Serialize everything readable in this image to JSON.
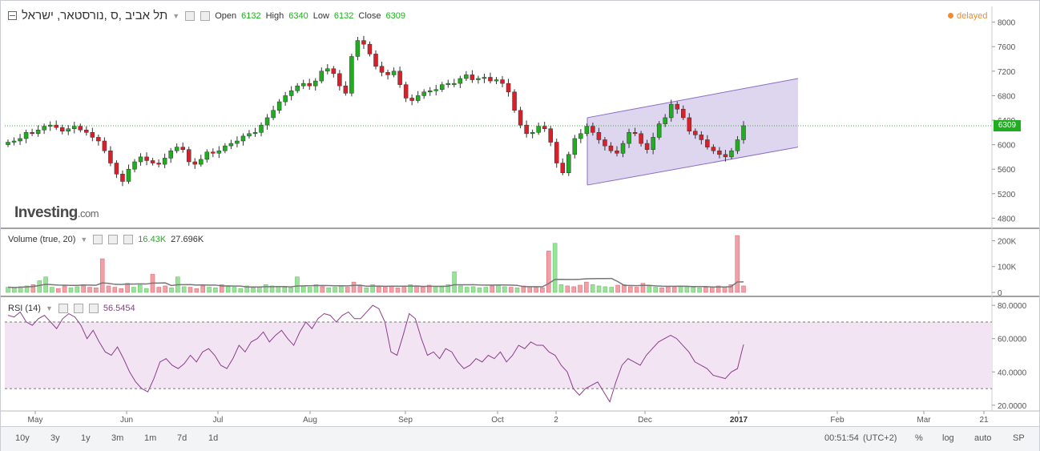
{
  "instrument_title": "תל אביב ,ס ,נורסטאר, ישראל",
  "ohlc": {
    "open_label": "Open",
    "open": "6132",
    "high_label": "High",
    "high": "6340",
    "low_label": "Low",
    "low": "6132",
    "close_label": "Close",
    "close": "6309"
  },
  "status": "delayed",
  "logo": {
    "main": "Investing",
    "suffix": ".com"
  },
  "volume_panel": {
    "label": "Volume (true, 20)",
    "value1": "16.43K",
    "value2": "27.696K"
  },
  "rsi_panel": {
    "label": "RSI (14)",
    "value": "56.5454"
  },
  "current_price_tag": "6309",
  "time_axis_labels": [
    "May",
    "Jun",
    "Jul",
    "Aug",
    "Sep",
    "Oct",
    "2",
    "Dec",
    "2017",
    "Feb",
    "Mar",
    "21"
  ],
  "range_buttons": [
    "10y",
    "3y",
    "1y",
    "3m",
    "1m",
    "7d",
    "1d"
  ],
  "right_controls": {
    "clock": "00:51:54",
    "tz": "(UTC+2)",
    "pct": "%",
    "log": "log",
    "auto": "auto",
    "sp": "SP"
  },
  "colors": {
    "up": "#1fae1f",
    "down": "#d9202a",
    "rsi_line": "#8a3d8a",
    "rsi_band": "#f3e4f3",
    "channel_fill": "#d8cfec",
    "channel_line": "#8c6cc5",
    "price_line": "#2db82d",
    "vol_ma": "#777777"
  },
  "chart_data": [
    {
      "type": "candlestick",
      "yticks": [
        "8000",
        "7600",
        "7200",
        "6800",
        "6400",
        "6000",
        "5600",
        "5200",
        "4800"
      ],
      "ylim": [
        4700,
        8100
      ],
      "xlim": [
        0,
        1
      ],
      "close_series": [
        6040,
        6060,
        6100,
        6200,
        6180,
        6240,
        6300,
        6320,
        6280,
        6220,
        6260,
        6300,
        6240,
        6200,
        6120,
        6060,
        5900,
        5700,
        5520,
        5400,
        5600,
        5720,
        5800,
        5740,
        5700,
        5680,
        5780,
        5900,
        5960,
        5920,
        5720,
        5680,
        5760,
        5880,
        5860,
        5900,
        5980,
        6020,
        6060,
        6140,
        6180,
        6200,
        6320,
        6440,
        6560,
        6700,
        6800,
        6880,
        6960,
        7000,
        6960,
        7040,
        7200,
        7240,
        7160,
        6960,
        6840,
        7440,
        7700,
        7640,
        7480,
        7280,
        7180,
        7140,
        7200,
        6980,
        6760,
        6720,
        6800,
        6860,
        6880,
        6900,
        6980,
        7000,
        7000,
        7080,
        7140,
        7060,
        7080,
        7100,
        7040,
        7060,
        7000,
        6860,
        6560,
        6320,
        6180,
        6200,
        6300,
        6260,
        6040,
        5700,
        5540,
        5840,
        6100,
        6180,
        6300,
        6200,
        6080,
        5980,
        5900,
        5860,
        6020,
        6200,
        6180,
        6020,
        5920,
        6120,
        6340,
        6440,
        6660,
        6580,
        6440,
        6220,
        6160,
        6080,
        5960,
        5900,
        5840,
        5800,
        5900,
        6080,
        6309
      ],
      "channel": {
        "upper_start": 6440,
        "upper_end": 7080,
        "lower_start": 5340,
        "lower_end": 5960
      },
      "last_price": 6309
    },
    {
      "type": "bar",
      "name": "Volume (true, 20)",
      "yticks": [
        "200K",
        "100K",
        "0"
      ],
      "ylim": [
        0,
        220000
      ],
      "values_k": [
        20,
        18,
        22,
        25,
        30,
        45,
        60,
        20,
        15,
        25,
        18,
        22,
        30,
        20,
        18,
        130,
        25,
        20,
        15,
        35,
        20,
        28,
        15,
        70,
        20,
        25,
        18,
        60,
        22,
        20,
        15,
        25,
        20,
        18,
        30,
        22,
        20,
        15,
        25,
        18,
        20,
        30,
        25,
        22,
        20,
        18,
        60,
        25,
        20,
        30,
        22,
        18,
        20,
        25,
        20,
        40,
        25,
        18,
        30,
        22,
        20,
        25,
        18,
        20,
        30,
        25,
        22,
        28,
        20,
        25,
        30,
        80,
        25,
        20,
        22,
        18,
        20,
        25,
        30,
        22,
        20,
        18,
        25,
        22,
        20,
        18,
        160,
        190,
        30,
        25,
        22,
        28,
        40,
        30,
        25,
        22,
        20,
        28,
        30,
        22,
        20,
        35,
        25,
        20,
        18,
        22,
        20,
        25,
        22,
        20,
        18,
        20,
        22,
        25,
        20,
        30,
        220,
        25
      ],
      "ma_k": 27.7,
      "last_values": [
        "16.43K",
        "27.696K"
      ]
    },
    {
      "type": "line",
      "name": "RSI (14)",
      "yticks": [
        "80.0000",
        "60.0000",
        "40.0000",
        "20.0000"
      ],
      "ylim": [
        18,
        82
      ],
      "levels": [
        70,
        30
      ],
      "values": [
        74,
        73,
        76,
        70,
        68,
        72,
        74,
        70,
        66,
        72,
        75,
        73,
        68,
        60,
        65,
        58,
        52,
        50,
        55,
        48,
        40,
        34,
        30,
        28,
        36,
        46,
        48,
        44,
        42,
        45,
        50,
        46,
        52,
        54,
        50,
        44,
        42,
        48,
        56,
        52,
        58,
        60,
        64,
        58,
        62,
        65,
        60,
        56,
        64,
        70,
        66,
        72,
        75,
        74,
        70,
        74,
        76,
        72,
        72,
        76,
        80,
        78,
        70,
        52,
        50,
        62,
        75,
        72,
        60,
        50,
        52,
        48,
        54,
        52,
        46,
        42,
        44,
        48,
        46,
        50,
        48,
        52,
        46,
        50,
        56,
        54,
        58,
        56,
        56,
        52,
        50,
        44,
        40,
        30,
        26,
        30,
        32,
        34,
        28,
        22,
        34,
        44,
        48,
        46,
        44,
        50,
        54,
        58,
        60,
        62,
        60,
        56,
        52,
        46,
        44,
        42,
        38,
        37,
        36,
        40,
        42,
        56.5
      ]
    }
  ]
}
